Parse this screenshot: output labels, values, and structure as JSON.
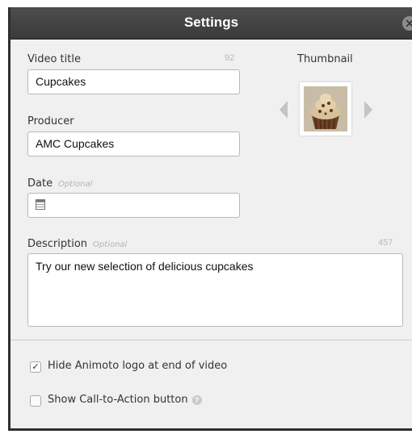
{
  "dialog": {
    "title": "Settings",
    "close_glyph": "✕"
  },
  "video_title": {
    "label": "Video title",
    "counter": "92",
    "value": "Cupcakes"
  },
  "thumbnail": {
    "label": "Thumbnail",
    "image_desc": "cupcake-thumbnail"
  },
  "producer": {
    "label": "Producer",
    "value": "AMC Cupcakes"
  },
  "date": {
    "label": "Date",
    "optional": "Optional",
    "value": "",
    "icon": "calendar-icon"
  },
  "description": {
    "label": "Description",
    "optional": "Optional",
    "counter": "457",
    "value": "Try our new selection of delicious cupcakes"
  },
  "options": {
    "hide_logo": {
      "label": "Hide Animoto logo at end of video",
      "checked": true,
      "glyph": "✓"
    },
    "cta": {
      "label": "Show Call-to-Action button",
      "checked": false,
      "help_glyph": "?"
    }
  },
  "colors": {
    "titlebar": "#3f3f3f",
    "panel": "#f0f0f0",
    "frosting": "#d9c29a",
    "cake": "#6b4226"
  }
}
